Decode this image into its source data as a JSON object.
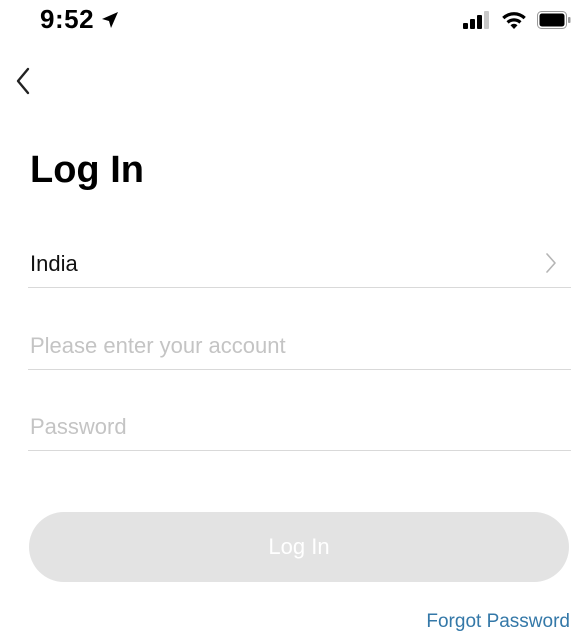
{
  "status_bar": {
    "time": "9:52",
    "icons": [
      "location-arrow-icon",
      "cellular-signal-icon",
      "wifi-icon",
      "battery-icon"
    ]
  },
  "nav": {
    "back_icon": "chevron-left-icon"
  },
  "page": {
    "title": "Log In"
  },
  "form": {
    "country": {
      "value": "India",
      "icon": "chevron-right-icon"
    },
    "account": {
      "value": "",
      "placeholder": "Please enter your account"
    },
    "password": {
      "value": "",
      "placeholder": "Password"
    },
    "login_button_label": "Log In",
    "forgot_password_label": "Forgot Password"
  },
  "colors": {
    "button_disabled_bg": "#e3e3e3",
    "button_text": "#ffffff",
    "link": "#3478a8",
    "placeholder": "#c4c4c4",
    "divider": "#d9d9d9"
  }
}
